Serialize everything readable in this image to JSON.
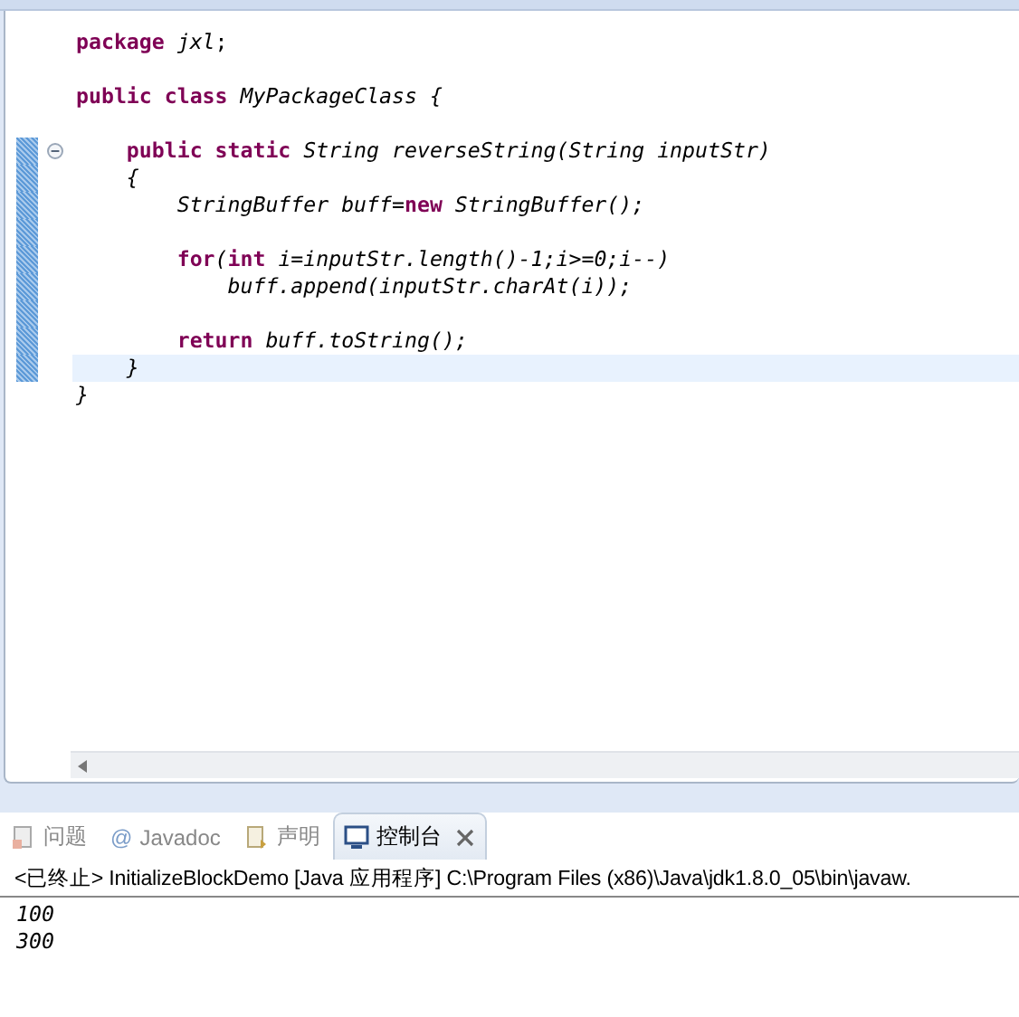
{
  "editor": {
    "lines": [
      {
        "changed": false,
        "current": false,
        "foldable": false,
        "segments": [
          {
            "kind": "keyword",
            "text": "package "
          },
          {
            "kind": "italic",
            "text": "jxl"
          },
          {
            "kind": "plain",
            "text": ";"
          }
        ]
      },
      {
        "changed": false,
        "current": false,
        "foldable": false
      },
      {
        "changed": false,
        "current": false,
        "foldable": false,
        "segments": [
          {
            "kind": "keyword",
            "text": "public class "
          },
          {
            "kind": "italic",
            "text": "MyPackageClass {"
          }
        ]
      },
      {
        "changed": false,
        "current": false,
        "foldable": false
      },
      {
        "changed": true,
        "current": false,
        "foldable": true,
        "segments": [
          {
            "kind": "keyword",
            "text": "    public static "
          },
          {
            "kind": "italic",
            "text": "String reverseString(String inputStr)"
          }
        ]
      },
      {
        "changed": true,
        "current": false,
        "foldable": false,
        "segments": [
          {
            "kind": "italic",
            "text": "    {"
          }
        ]
      },
      {
        "changed": true,
        "current": false,
        "foldable": false,
        "segments": [
          {
            "kind": "italic",
            "text": "        StringBuffer buff="
          },
          {
            "kind": "keyword",
            "text": "new "
          },
          {
            "kind": "italic",
            "text": "StringBuffer();"
          }
        ]
      },
      {
        "changed": true,
        "current": false,
        "foldable": false
      },
      {
        "changed": true,
        "current": false,
        "foldable": false,
        "segments": [
          {
            "kind": "keyword",
            "text": "        for"
          },
          {
            "kind": "italic",
            "text": "("
          },
          {
            "kind": "keyword",
            "text": "int "
          },
          {
            "kind": "italic",
            "text": "i=inputStr.length()-1;i>=0;i--)"
          }
        ]
      },
      {
        "changed": true,
        "current": false,
        "foldable": false,
        "segments": [
          {
            "kind": "italic",
            "text": "            buff.append(inputStr.charAt(i));"
          }
        ]
      },
      {
        "changed": true,
        "current": false,
        "foldable": false
      },
      {
        "changed": true,
        "current": false,
        "foldable": false,
        "segments": [
          {
            "kind": "keyword",
            "text": "        return "
          },
          {
            "kind": "italic",
            "text": "buff.toString();"
          }
        ]
      },
      {
        "changed": true,
        "current": true,
        "foldable": false,
        "segments": [
          {
            "kind": "italic",
            "text": "    }"
          }
        ]
      },
      {
        "changed": false,
        "current": false,
        "foldable": false,
        "segments": [
          {
            "kind": "italic",
            "text": "}"
          }
        ]
      }
    ]
  },
  "console_panel": {
    "tabs": [
      {
        "kind": "problems",
        "label": "问题",
        "selected": false
      },
      {
        "kind": "javadoc",
        "glyph": "@",
        "label": "Javadoc",
        "selected": false
      },
      {
        "kind": "declaration",
        "label": "声明",
        "selected": false
      },
      {
        "kind": "console",
        "label": "控制台",
        "selected": true
      }
    ],
    "status": "<已终止> InitializeBlockDemo [Java 应用程序] C:\\Program Files (x86)\\Java\\jdk1.8.0_05\\bin\\javaw.",
    "output": [
      "100",
      "300"
    ]
  }
}
